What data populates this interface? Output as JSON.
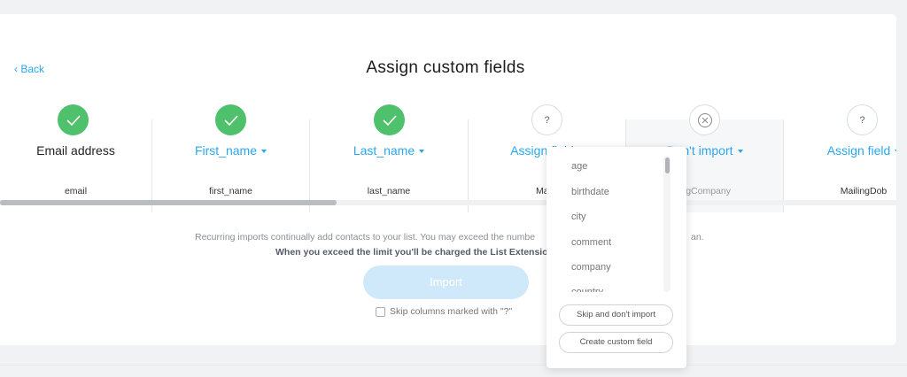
{
  "header": {
    "back_label": "Back",
    "title": "Assign custom fields"
  },
  "columns": [
    {
      "status": "ok",
      "field": "Email address",
      "source": "email"
    },
    {
      "status": "ok",
      "field": "First_name",
      "source": "first_name"
    },
    {
      "status": "ok",
      "field": "Last_name",
      "source": "last_name"
    },
    {
      "status": "unknown",
      "status_glyph": "?",
      "field": "Assign field",
      "source": "Mailir"
    },
    {
      "status": "skip",
      "field": "Don't import",
      "source": "ingCompany"
    },
    {
      "status": "unknown",
      "status_glyph": "?",
      "field": "Assign field",
      "source": "MailingDob"
    }
  ],
  "notice": {
    "line1": "Recurring imports continually add contacts to your list. You may exceed the numbe",
    "line1_tail": "an.",
    "line2": "When you exceed the limit you'll be charged the List Extension"
  },
  "import_button": "Import",
  "skip_checkbox": {
    "label": "Skip columns marked with \"?\"",
    "checked": false
  },
  "dropdown": {
    "options": [
      "age",
      "birthdate",
      "city",
      "comment",
      "company",
      "country"
    ],
    "skip_label": "Skip and don't import",
    "create_label": "Create custom field"
  },
  "colors": {
    "accent": "#2aa7ee",
    "success": "#4fc06b",
    "import_disabled": "#cfe9fb"
  }
}
